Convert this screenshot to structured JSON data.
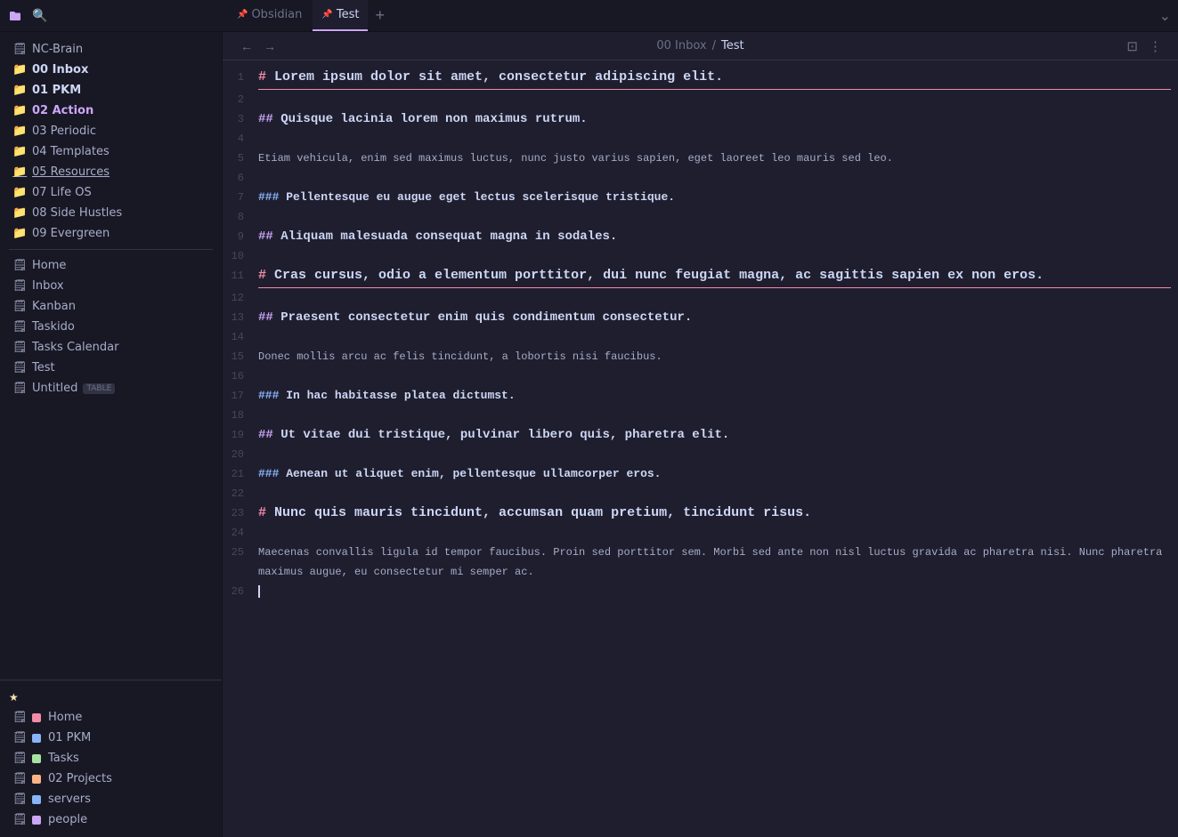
{
  "titleBar": {
    "appName": "Obsidian",
    "tabs": [
      {
        "label": "Obsidian",
        "active": false,
        "pinned": true
      },
      {
        "label": "Test",
        "active": true,
        "pinned": true
      }
    ],
    "addTabLabel": "+",
    "moreLabel": "⌄"
  },
  "breadcrumb": {
    "navBack": "←",
    "navForward": "→",
    "folder": "00 Inbox",
    "separator": "/",
    "current": "Test"
  },
  "editorIcons": {
    "openSidepanel": "⊡",
    "moreOptions": "⋮"
  },
  "sidebar": {
    "topItems": [
      {
        "id": "nc-brain",
        "icon": "file",
        "iconColor": "file",
        "label": "NC-Brain",
        "active": false
      },
      {
        "id": "00-inbox",
        "icon": "📁",
        "iconColor": "folder-red",
        "label": "00 Inbox",
        "active": false,
        "bold": true
      },
      {
        "id": "01-pkm",
        "icon": "📁",
        "iconColor": "folder-green",
        "label": "01 PKM",
        "active": false,
        "bold": true
      },
      {
        "id": "02-action",
        "icon": "📁",
        "iconColor": "folder-green",
        "label": "02 Action",
        "active": false,
        "bold": true,
        "highlight": "purple"
      },
      {
        "id": "03-periodic",
        "icon": "📁",
        "iconColor": "folder",
        "label": "03 Periodic",
        "active": false
      },
      {
        "id": "04-templates",
        "icon": "📁",
        "iconColor": "folder",
        "label": "04 Templates",
        "active": false
      },
      {
        "id": "05-resources",
        "icon": "📁",
        "iconColor": "folder",
        "label": "05 Resources",
        "active": false,
        "underline": true
      },
      {
        "id": "07-life-os",
        "icon": "📁",
        "iconColor": "folder",
        "label": "07 Life OS",
        "active": false
      },
      {
        "id": "08-side-hustles",
        "icon": "📁",
        "iconColor": "folder",
        "label": "08 Side Hustles",
        "active": false
      },
      {
        "id": "09-evergreen",
        "icon": "📁",
        "iconColor": "folder-red",
        "label": "09 Evergreen",
        "active": false
      },
      {
        "id": "home",
        "icon": "🗒",
        "iconColor": "file",
        "label": "Home",
        "active": false
      },
      {
        "id": "inbox",
        "icon": "🗒",
        "iconColor": "file",
        "label": "Inbox",
        "active": false
      },
      {
        "id": "kanban",
        "icon": "🗒",
        "iconColor": "file",
        "label": "Kanban",
        "active": false
      },
      {
        "id": "taskido",
        "icon": "🗒",
        "iconColor": "file",
        "label": "Taskido",
        "active": false
      },
      {
        "id": "tasks-calendar",
        "icon": "🗒",
        "iconColor": "file",
        "label": "Tasks Calendar",
        "active": false
      },
      {
        "id": "test",
        "icon": "🗒",
        "iconColor": "file",
        "label": "Test",
        "active": false
      },
      {
        "id": "untitled",
        "icon": "🗒",
        "iconColor": "file",
        "label": "Untitled",
        "badge": "TABLE",
        "active": false
      }
    ],
    "starredHeader": "★",
    "starredItems": [
      {
        "id": "s-home",
        "icon": "🗒",
        "colorIcon": "#f38ba8",
        "label": "Home"
      },
      {
        "id": "s-01pkm",
        "icon": "🗒",
        "colorIcon": "#89b4fa",
        "label": "01 PKM"
      },
      {
        "id": "s-tasks",
        "icon": "🗒",
        "colorIcon": "#a6e3a1",
        "label": "Tasks"
      },
      {
        "id": "s-02projects",
        "icon": "🗒",
        "colorIcon": "#fab387",
        "label": "02 Projects"
      },
      {
        "id": "s-servers",
        "icon": "🗒",
        "colorIcon": "#89b4fa",
        "label": "servers"
      },
      {
        "id": "s-people",
        "icon": "🗒",
        "colorIcon": "#cba6f7",
        "label": "people"
      }
    ]
  },
  "editor": {
    "lines": [
      {
        "num": 1,
        "type": "h1",
        "text": "# Lorem ipsum dolor sit amet, consectetur adipiscing elit.",
        "hasSeparator": true
      },
      {
        "num": 2,
        "type": "empty",
        "text": ""
      },
      {
        "num": 3,
        "type": "h2",
        "text": "## Quisque lacinia lorem non maximus rutrum."
      },
      {
        "num": 4,
        "type": "empty",
        "text": ""
      },
      {
        "num": 5,
        "type": "plain",
        "text": "Etiam vehicula, enim sed maximus luctus, nunc justo varius sapien, eget laoreet leo mauris sed leo."
      },
      {
        "num": 6,
        "type": "empty",
        "text": ""
      },
      {
        "num": 7,
        "type": "h3",
        "text": "### Pellentesque eu augue eget lectus scelerisque tristique."
      },
      {
        "num": 8,
        "type": "empty",
        "text": ""
      },
      {
        "num": 9,
        "type": "h2",
        "text": "## Aliquam malesuada consequat magna in sodales."
      },
      {
        "num": 10,
        "type": "empty",
        "text": ""
      },
      {
        "num": 11,
        "type": "h1",
        "text": "# Cras cursus, odio a elementum porttitor, dui nunc feugiat magna, ac sagittis sapien ex non eros.",
        "hasSeparator": true
      },
      {
        "num": 12,
        "type": "empty",
        "text": ""
      },
      {
        "num": 13,
        "type": "h2",
        "text": "## Praesent consectetur enim quis condimentum consectetur."
      },
      {
        "num": 14,
        "type": "empty",
        "text": ""
      },
      {
        "num": 15,
        "type": "plain",
        "text": "Donec mollis arcu ac felis tincidunt, a lobortis nisi faucibus."
      },
      {
        "num": 16,
        "type": "empty",
        "text": ""
      },
      {
        "num": 17,
        "type": "h3",
        "text": "### In hac habitasse platea dictumst."
      },
      {
        "num": 18,
        "type": "empty",
        "text": ""
      },
      {
        "num": 19,
        "type": "h2",
        "text": "## Ut vitae dui tristique, pulvinar libero quis, pharetra elit."
      },
      {
        "num": 20,
        "type": "empty",
        "text": ""
      },
      {
        "num": 21,
        "type": "h3",
        "text": "### Aenean ut aliquet enim, pellentesque ullamcorper eros."
      },
      {
        "num": 22,
        "type": "empty",
        "text": ""
      },
      {
        "num": 23,
        "type": "h1",
        "text": "# Nunc quis mauris tincidunt, accumsan quam pretium, tincidunt risus.",
        "hasSeparator": false
      },
      {
        "num": 24,
        "type": "empty",
        "text": ""
      },
      {
        "num": 25,
        "type": "plain",
        "text": "Maecenas convallis ligula id tempor faucibus. Proin sed porttitor sem. Morbi sed ante non nisl luctus gravida ac pharetra nisi. Nunc pharetra maximus augue, eu consectetur mi semper ac."
      },
      {
        "num": 26,
        "type": "cursor",
        "text": ""
      }
    ]
  }
}
